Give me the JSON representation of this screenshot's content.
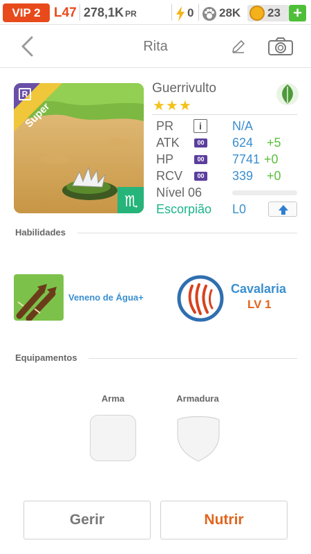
{
  "status": {
    "vip": "VIP 2",
    "level": "L47",
    "gold": "278,1K",
    "gold_unit": "PR",
    "energy": "0",
    "paws": "28K",
    "coins": "23",
    "add": "+"
  },
  "header": {
    "title": "Rita"
  },
  "pet": {
    "rarity_badge": "R",
    "ribbon": "Super",
    "name": "Guerrivulto",
    "stars": "★★★",
    "stats": {
      "pr_label": "PR",
      "pr_info": "i",
      "pr_value": "N/A",
      "atk_label": "ATK",
      "atk_badge": "00",
      "atk_value": "624",
      "atk_bonus": "+5",
      "hp_label": "HP",
      "hp_badge": "00",
      "hp_value": "7741",
      "hp_bonus": "+0",
      "rcv_label": "RCV",
      "rcv_badge": "00",
      "rcv_value": "339",
      "rcv_bonus": "+0",
      "level_label": "Nível 06",
      "zodiac_label": "Escorpião",
      "zodiac_level": "L0"
    }
  },
  "skills": {
    "title": "Habilidades",
    "skill1": "Veneno de Água+",
    "skill2_name": "Cavalaria",
    "skill2_level": "LV 1"
  },
  "equipment": {
    "title": "Equipamentos",
    "weapon": "Arma",
    "armor": "Armadura"
  },
  "actions": {
    "manage": "Gerir",
    "feed": "Nutrir"
  },
  "colors": {
    "accent_orange": "#e84a1c",
    "stat_blue": "#3a8fd0",
    "bonus_green": "#5bbf3a",
    "zodiac_teal": "#1bb58a"
  }
}
